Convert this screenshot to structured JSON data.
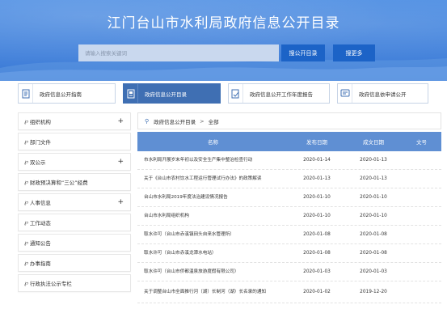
{
  "header": {
    "title": "江门台山市水利局政府信息公开目录",
    "search_placeholder": "请输入搜索关键词",
    "search_button": "搜公开目录",
    "more_button": "搜更多"
  },
  "tabs": [
    {
      "label": "政府信息公开指南",
      "icon": "document-icon"
    },
    {
      "label": "政府信息公开目录",
      "icon": "catalog-icon"
    },
    {
      "label": "政府信息公开工作年度报告",
      "icon": "report-icon"
    },
    {
      "label": "政府信息依申请公开",
      "icon": "application-icon"
    }
  ],
  "sidebar": {
    "items": [
      {
        "label": "组织机构",
        "expand": "+"
      },
      {
        "label": "部门文件",
        "expand": ""
      },
      {
        "label": "双公示",
        "expand": "+"
      },
      {
        "label": "财政预决算和“三公”经费",
        "expand": ""
      },
      {
        "label": "人事信息",
        "expand": "+"
      },
      {
        "label": "工作动态",
        "expand": ""
      },
      {
        "label": "通知公告",
        "expand": ""
      },
      {
        "label": "办事指南",
        "expand": ""
      },
      {
        "label": "行政执法公示专栏",
        "expand": ""
      }
    ]
  },
  "breadcrumb": {
    "root": "政府信息公开目录",
    "separator": ">",
    "current": "全部"
  },
  "table": {
    "headers": {
      "name": "名称",
      "published": "发布日期",
      "effective": "成文日期",
      "doc_no": "文号"
    },
    "rows": [
      {
        "name": "市水利局开展岁末年初以及安全生产集中整治检查行动",
        "published": "2020-01-14",
        "effective": "2020-01-13",
        "doc_no": ""
      },
      {
        "name": "关于《台山市农村饮水工程运行管理试行办法》的政策解读",
        "published": "2020-01-13",
        "effective": "2020-01-13",
        "doc_no": ""
      },
      {
        "name": "台山市水利局2019年度法治建设情况报告",
        "published": "2020-01-10",
        "effective": "2020-01-10",
        "doc_no": ""
      },
      {
        "name": "台山市水利局组织机构",
        "published": "2020-01-10",
        "effective": "2020-01-10",
        "doc_no": ""
      },
      {
        "name": "取水许可（台山市赤溪镇田头自来水管理所）",
        "published": "2020-01-08",
        "effective": "2020-01-08",
        "doc_no": ""
      },
      {
        "name": "取水许可（台山市赤溪龙潭水电站）",
        "published": "2020-01-08",
        "effective": "2020-01-08",
        "doc_no": ""
      },
      {
        "name": "取水许可（台山市侨都温泉旅游度假有限公司）",
        "published": "2020-01-03",
        "effective": "2020-01-03",
        "doc_no": ""
      },
      {
        "name": "关于调整台山市全面推行河（湖）长制河（湖）长名录的通知",
        "published": "2020-01-02",
        "effective": "2019-12-20",
        "doc_no": ""
      }
    ]
  },
  "colors": {
    "banner": "#3a79d6",
    "button": "#1c63c7",
    "active_tab": "#3f6fb3",
    "table_header": "#5f8fd3"
  }
}
